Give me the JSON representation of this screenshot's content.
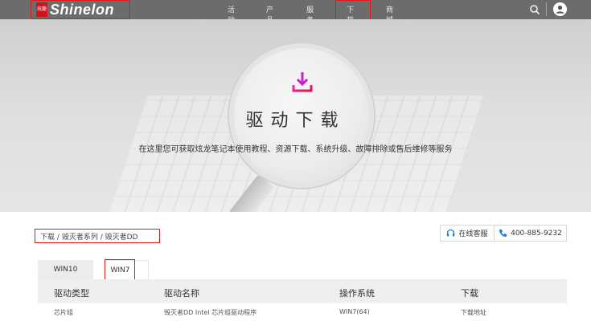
{
  "header": {
    "logo_mark": "炫龍",
    "logo_text": "Shinelon",
    "nav": [
      "活动",
      "产品",
      "服务",
      "下载",
      "商城"
    ],
    "search_icon": "search-icon",
    "user_icon": "user-icon"
  },
  "hero": {
    "icon": "download-icon",
    "title": "驱动下载",
    "subtitle": "在这里您可获取炫龙笔记本使用教程、资源下载、系统升级、故障排除或售后维修等服务"
  },
  "breadcrumb": [
    "下载",
    "毁灭者系列",
    "毁灭者DD"
  ],
  "breadcrumb_sep": "/",
  "contact": {
    "service_label": "在线客服",
    "phone": "400-885-9232"
  },
  "tabs": [
    "WIN10",
    "WIN7"
  ],
  "table": {
    "headers": [
      "驱动类型",
      "驱动名称",
      "操作系统",
      "下载"
    ],
    "rows": [
      [
        "芯片组",
        "毁灭者DD Intel 芯片组驱动程序",
        "WIN7(64)",
        "下载地址"
      ]
    ]
  },
  "colors": {
    "highlight_box": "#e01818",
    "download_icon": "#d01fd8",
    "header_bg": "#6c6c6c",
    "phone_icon": "#1a7fd8"
  }
}
